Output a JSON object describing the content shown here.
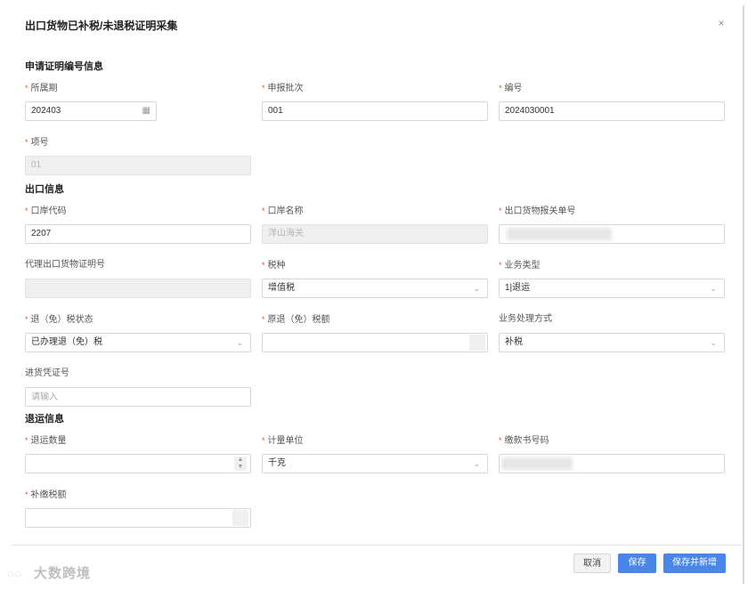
{
  "dialog": {
    "title": "出口货物已补税/未退税证明采集",
    "close_glyph": "×"
  },
  "sections": {
    "application": "申请证明编号信息",
    "export": "出口信息",
    "return": "退运信息"
  },
  "fields": {
    "period": {
      "label": "所属期",
      "value": "202403"
    },
    "batch": {
      "label": "申报批次",
      "value": "001"
    },
    "number": {
      "label": "编号",
      "value": "2024030001"
    },
    "item_no": {
      "label": "项号",
      "value": "01"
    },
    "port_code": {
      "label": "口岸代码",
      "value": "2207"
    },
    "port_name": {
      "label": "口岸名称",
      "value": "洋山海关"
    },
    "customs_decl_no": {
      "label": "出口货物报关单号",
      "value": ""
    },
    "agent_cert_no": {
      "label": "代理出口货物证明号",
      "value": ""
    },
    "tax_type": {
      "label": "税种",
      "value": "增值税"
    },
    "biz_type": {
      "label": "业务类型",
      "value": "1|退运"
    },
    "refund_status": {
      "label": "退（免）税状态",
      "value": "已办理退（免）税"
    },
    "orig_refund_amount": {
      "label": "原退（免）税额",
      "value": ""
    },
    "biz_method": {
      "label": "业务处理方式",
      "value": "补税"
    },
    "invoice_no": {
      "label": "进货凭证号",
      "placeholder": "请输入"
    },
    "return_qty": {
      "label": "退运数量",
      "value": ""
    },
    "unit": {
      "label": "计量单位",
      "value": "千克"
    },
    "payment_no": {
      "label": "缴款书号码",
      "value": ""
    },
    "supp_tax": {
      "label": "补缴税额",
      "value": ""
    }
  },
  "footer": {
    "cancel": "取消",
    "save": "保存",
    "save_new": "保存并新增"
  },
  "watermark": {
    "text": "大数跨境",
    "icon": "logo-icon"
  },
  "colors": {
    "primary": "#4a86e8",
    "required": "#e0503c"
  }
}
